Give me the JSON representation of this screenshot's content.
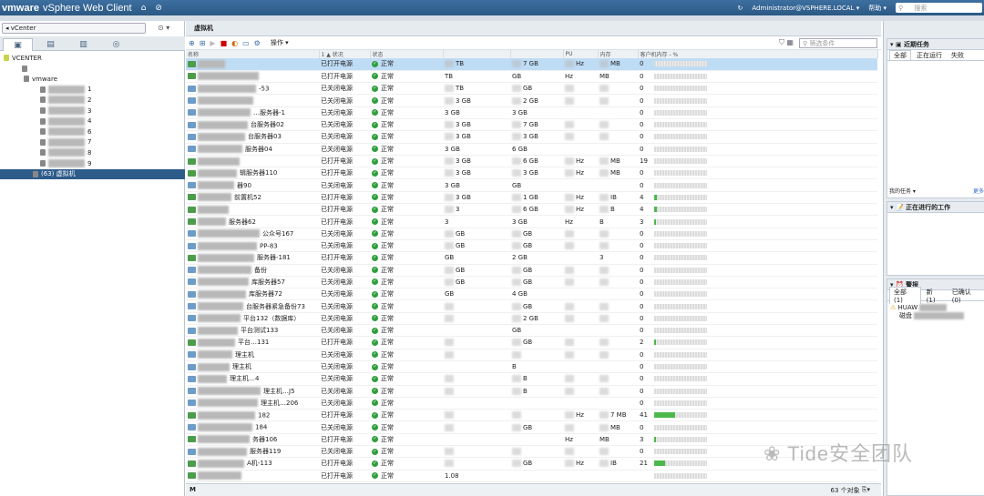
{
  "topbar": {
    "logo": "vmware",
    "product": "vSphere Web Client",
    "user": "Administrator@VSPHERE.LOCAL ▾",
    "help": "帮助 ▾",
    "search_placeholder": "搜索"
  },
  "nav": {
    "selector": "vCenter",
    "tree": [
      {
        "label": "VCENTER",
        "indent": 4
      },
      {
        "label": "",
        "indent": 24
      },
      {
        "label": "vmware",
        "indent": 26
      },
      {
        "label": "1",
        "indent": 44
      },
      {
        "label": "2",
        "indent": 44
      },
      {
        "label": "3",
        "indent": 44
      },
      {
        "label": "4",
        "indent": 44
      },
      {
        "label": "6",
        "indent": 44
      },
      {
        "label": "7",
        "indent": 44
      },
      {
        "label": "8",
        "indent": 44
      },
      {
        "label": "9",
        "indent": 44
      },
      {
        "label": "(63) 虚拟机",
        "indent": 36
      }
    ]
  },
  "center": {
    "title": "虚拟机",
    "actions_label": "操作 ▾",
    "filter_placeholder": "筛选条件",
    "columns": [
      "名称",
      "1 ▲ 状况",
      "状态",
      "",
      "",
      "PU",
      "内存",
      "客户机内存 - %"
    ],
    "rows": [
      {
        "name": "",
        "cond": "已打开电源",
        "st": "正常",
        "c4": "TB",
        "c5": "7 GB",
        "c6": "Hz",
        "c7": "MB",
        "c8": "0",
        "pct": 0,
        "sel": true
      },
      {
        "name": "",
        "cond": "已打开电源",
        "st": "正常",
        "c4": "TB",
        "c5": "GB",
        "c6": "Hz",
        "c7": "MB",
        "c8": "0",
        "pct": 0
      },
      {
        "name": "-53",
        "cond": "已关闭电源",
        "st": "正常",
        "c4": "TB",
        "c5": "GB",
        "c6": "",
        "c7": "",
        "c8": "0",
        "pct": 0
      },
      {
        "name": "",
        "cond": "已关闭电源",
        "st": "正常",
        "c4": "3 GB",
        "c5": "2 GB",
        "c6": "",
        "c7": "",
        "c8": "0",
        "pct": 0
      },
      {
        "name": "…服务器-1",
        "cond": "已关闭电源",
        "st": "正常",
        "c4": "3 GB",
        "c5": "3 GB",
        "c6": "",
        "c7": "",
        "c8": "0",
        "pct": 0
      },
      {
        "name": "台服务器02",
        "cond": "已关闭电源",
        "st": "正常",
        "c4": "3 GB",
        "c5": "7 GB",
        "c6": "",
        "c7": "",
        "c8": "0",
        "pct": 0
      },
      {
        "name": "台服务器03",
        "cond": "已关闭电源",
        "st": "正常",
        "c4": "3 GB",
        "c5": "3 GB",
        "c6": "",
        "c7": "",
        "c8": "0",
        "pct": 0
      },
      {
        "name": "服务器04",
        "cond": "已关闭电源",
        "st": "正常",
        "c4": "3 GB",
        "c5": "6 GB",
        "c6": "",
        "c7": "",
        "c8": "0",
        "pct": 0
      },
      {
        "name": "",
        "cond": "已打开电源",
        "st": "正常",
        "c4": "3 GB",
        "c5": "6 GB",
        "c6": "Hz",
        "c7": "MB",
        "c8": "19",
        "pct": 0
      },
      {
        "name": "辑服务器110",
        "cond": "已打开电源",
        "st": "正常",
        "c4": "3 GB",
        "c5": "3 GB",
        "c6": "Hz",
        "c7": "MB",
        "c8": "0",
        "pct": 0
      },
      {
        "name": "器90",
        "cond": "已关闭电源",
        "st": "正常",
        "c4": "3 GB",
        "c5": "GB",
        "c6": "",
        "c7": "",
        "c8": "0",
        "pct": 0
      },
      {
        "name": "前置机52",
        "cond": "已打开电源",
        "st": "正常",
        "c4": "3 GB",
        "c5": "1 GB",
        "c6": "Hz",
        "c7": "IB",
        "c8": "4",
        "pct": 5
      },
      {
        "name": "",
        "cond": "已打开电源",
        "st": "正常",
        "c4": "3",
        "c5": "6 GB",
        "c6": "Hz",
        "c7": "B",
        "c8": "4",
        "pct": 5
      },
      {
        "name": "服务器62",
        "cond": "已打开电源",
        "st": "正常",
        "c4": "3",
        "c5": "3 GB",
        "c6": "Hz",
        "c7": "B",
        "c8": "3",
        "pct": 4
      },
      {
        "name": "公众号167",
        "cond": "已关闭电源",
        "st": "正常",
        "c4": "GB",
        "c5": "GB",
        "c6": "",
        "c7": "",
        "c8": "0",
        "pct": 0
      },
      {
        "name": "PP-83",
        "cond": "已关闭电源",
        "st": "正常",
        "c4": "GB",
        "c5": "GB",
        "c6": "",
        "c7": "",
        "c8": "0",
        "pct": 0
      },
      {
        "name": "服务器-181",
        "cond": "已打开电源",
        "st": "正常",
        "c4": "GB",
        "c5": "2 GB",
        "c6": "",
        "c7": "3",
        "c8": "0",
        "pct": 0
      },
      {
        "name": "备份",
        "cond": "已关闭电源",
        "st": "正常",
        "c4": "GB",
        "c5": "GB",
        "c6": "",
        "c7": "",
        "c8": "0",
        "pct": 0
      },
      {
        "name": "库服务器57",
        "cond": "已关闭电源",
        "st": "正常",
        "c4": "GB",
        "c5": "GB",
        "c6": "",
        "c7": "",
        "c8": "0",
        "pct": 0
      },
      {
        "name": "库服务器72",
        "cond": "已关闭电源",
        "st": "正常",
        "c4": "GB",
        "c5": "4 GB",
        "c6": "",
        "c7": "",
        "c8": "0",
        "pct": 0
      },
      {
        "name": "台服务器紧急备份73",
        "cond": "已关闭电源",
        "st": "正常",
        "c4": "",
        "c5": "GB",
        "c6": "",
        "c7": "",
        "c8": "0",
        "pct": 0
      },
      {
        "name": "平台132（数据库）",
        "cond": "已关闭电源",
        "st": "正常",
        "c4": "",
        "c5": "2 GB",
        "c6": "",
        "c7": "",
        "c8": "0",
        "pct": 0
      },
      {
        "name": "平台测试133",
        "cond": "已关闭电源",
        "st": "正常",
        "c4": "",
        "c5": "GB",
        "c6": "",
        "c7": "",
        "c8": "0",
        "pct": 0
      },
      {
        "name": "平台…131",
        "cond": "已打开电源",
        "st": "正常",
        "c4": "",
        "c5": "GB",
        "c6": "",
        "c7": "",
        "c8": "2",
        "pct": 4
      },
      {
        "name": "理主机",
        "cond": "已关闭电源",
        "st": "正常",
        "c4": "",
        "c5": "",
        "c6": "",
        "c7": "",
        "c8": "0",
        "pct": 0
      },
      {
        "name": "理主机",
        "cond": "已关闭电源",
        "st": "正常",
        "c4": "",
        "c5": "B",
        "c6": "",
        "c7": "",
        "c8": "0",
        "pct": 0
      },
      {
        "name": "理主机…4",
        "cond": "已关闭电源",
        "st": "正常",
        "c4": "",
        "c5": "B",
        "c6": "",
        "c7": "",
        "c8": "0",
        "pct": 0
      },
      {
        "name": "理主机…J5",
        "cond": "已关闭电源",
        "st": "正常",
        "c4": "",
        "c5": "B",
        "c6": "",
        "c7": "",
        "c8": "0",
        "pct": 0
      },
      {
        "name": "理主机…206",
        "cond": "已关闭电源",
        "st": "正常",
        "c4": "",
        "c5": "",
        "c6": "",
        "c7": "",
        "c8": "0",
        "pct": 0
      },
      {
        "name": "182",
        "cond": "已打开电源",
        "st": "正常",
        "c4": "",
        "c5": "",
        "c6": "Hz",
        "c7": "7 MB",
        "c8": "41",
        "pct": 40
      },
      {
        "name": "184",
        "cond": "已关闭电源",
        "st": "正常",
        "c4": "",
        "c5": "GB",
        "c6": "",
        "c7": "MB",
        "c8": "0",
        "pct": 0
      },
      {
        "name": "务器106",
        "cond": "已打开电源",
        "st": "正常",
        "c4": "",
        "c5": "",
        "c6": "Hz",
        "c7": "MB",
        "c8": "3",
        "pct": 4
      },
      {
        "name": "服务器119",
        "cond": "已关闭电源",
        "st": "正常",
        "c4": "",
        "c5": "",
        "c6": "",
        "c7": "",
        "c8": "0",
        "pct": 0
      },
      {
        "name": "A机-113",
        "cond": "已打开电源",
        "st": "正常",
        "c4": "",
        "c5": "GB",
        "c6": "Hz",
        "c7": "IB",
        "c8": "21",
        "pct": 20
      },
      {
        "name": "",
        "cond": "已打开电源",
        "st": "正常",
        "c4": "1.08",
        "c5": "",
        "c6": "",
        "c7": "",
        "c8": "",
        "pct": 0
      }
    ],
    "footer_count": "63 个对象"
  },
  "right": {
    "recent_tasks": "近期任务",
    "tabs": [
      "全部",
      "正在运行",
      "失败"
    ],
    "my_tasks": "我的任务 ▾",
    "more": "更多",
    "in_progress": "正在进行的工作",
    "alarms": "警报",
    "alarm_tabs": [
      "全部 (1)",
      "新 (1)",
      "已确认 (0)"
    ],
    "alarm_item": "HUAW",
    "alarm_sub": "磁盘"
  },
  "watermark": "Tide安全团队"
}
